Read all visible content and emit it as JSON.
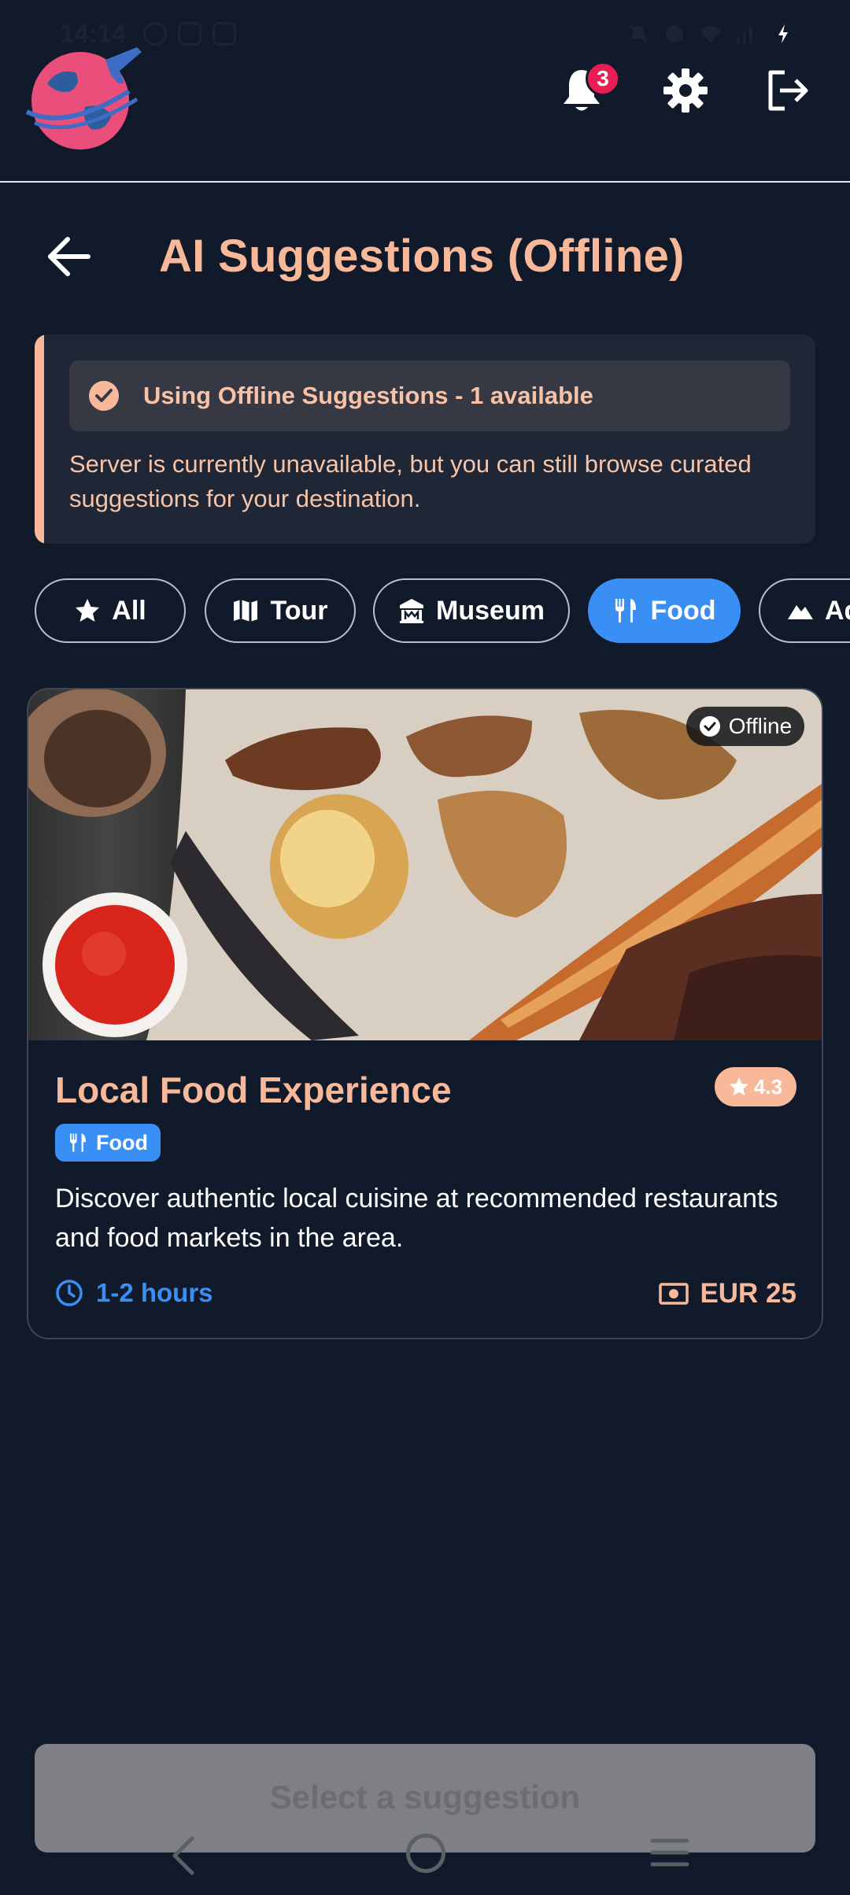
{
  "status_bar": {
    "time": "14:14"
  },
  "header": {
    "logo": "globe-plane-logo",
    "notification_count": "3",
    "icons": [
      "bell-icon",
      "gear-icon",
      "logout-icon"
    ]
  },
  "page": {
    "title": "AI Suggestions (Offline)"
  },
  "notice": {
    "heading": "Using Offline Suggestions - 1 available",
    "body": "Server is currently unavailable, but you can still browse curated suggestions for your destination."
  },
  "filters": [
    {
      "label": "All",
      "icon": "star-icon",
      "active": false
    },
    {
      "label": "Tour",
      "icon": "map-icon",
      "active": false
    },
    {
      "label": "Museum",
      "icon": "museum-icon",
      "active": false
    },
    {
      "label": "Food",
      "icon": "utensils-icon",
      "active": true
    },
    {
      "label": "Ad",
      "icon": "mountain-icon",
      "active": false
    }
  ],
  "card": {
    "offline_label": "Offline",
    "title": "Local Food Experience",
    "rating": "4.3",
    "category": "Food",
    "description": "Discover authentic local cuisine at recommended restaurants and food markets in the area.",
    "duration": "1-2 hours",
    "price": "EUR 25"
  },
  "footer": {
    "button_label": "Select a suggestion"
  },
  "colors": {
    "accent": "#f8b99a",
    "primary": "#3a8ff5",
    "background": "#111a2b",
    "badge": "#e91e55"
  }
}
